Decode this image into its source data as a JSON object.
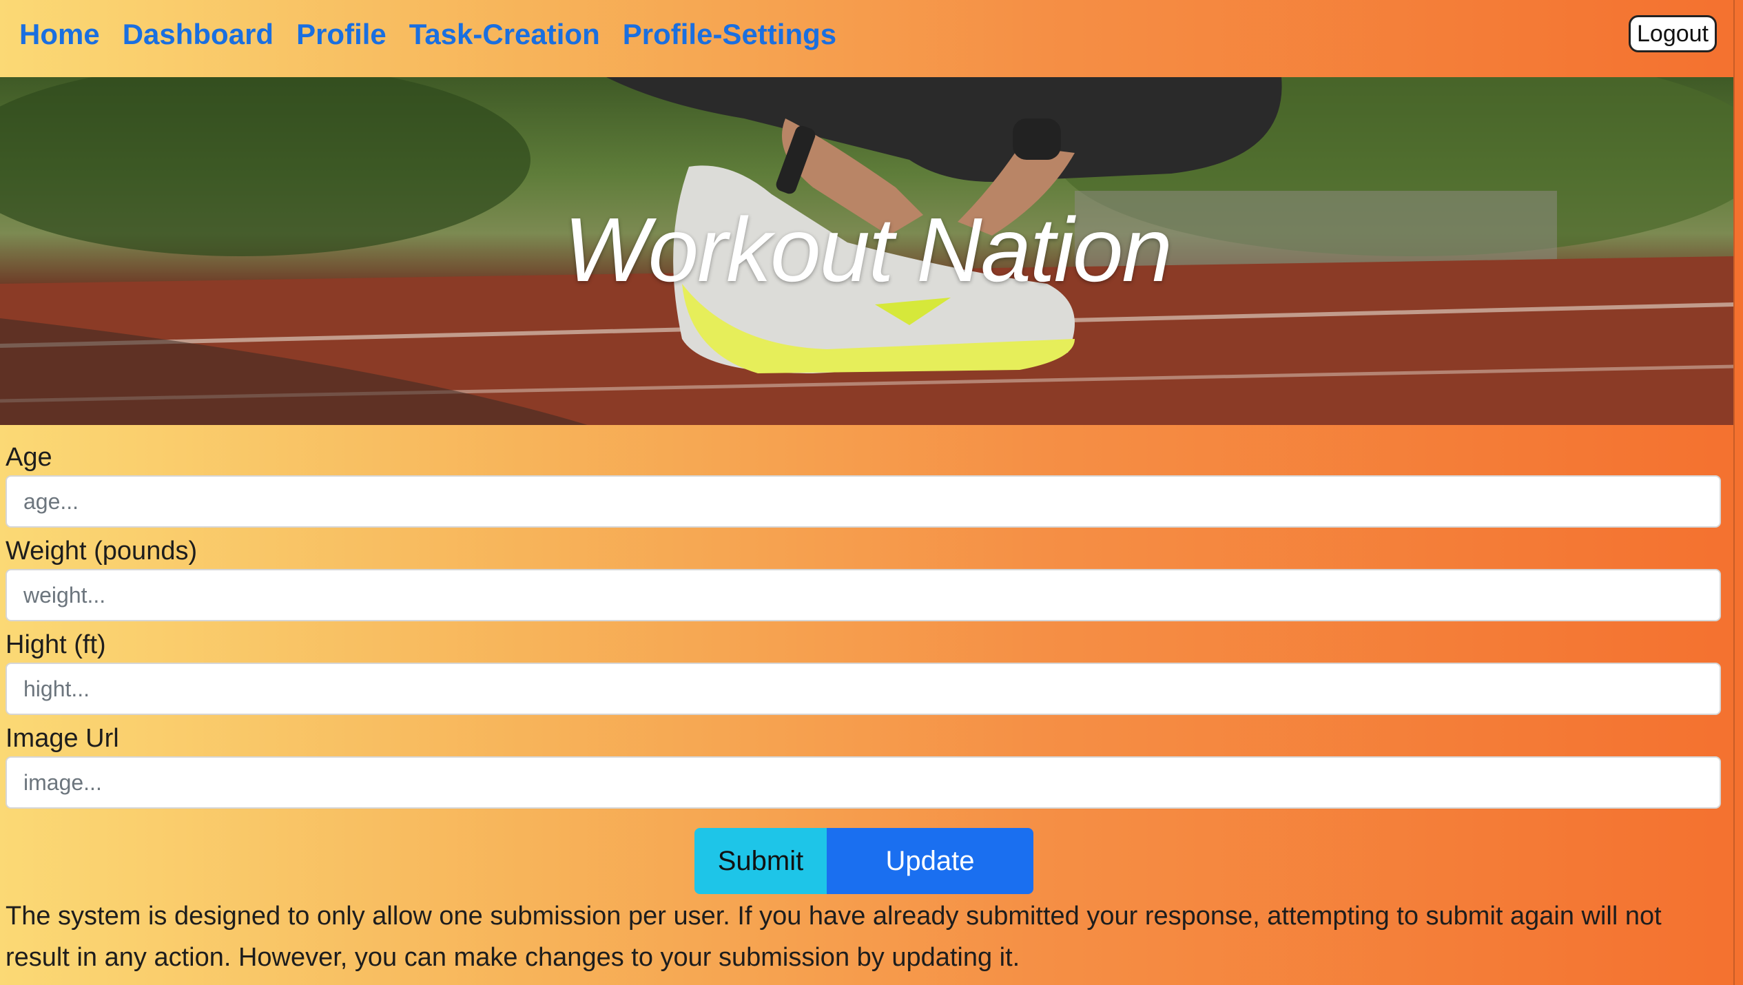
{
  "nav": {
    "links": [
      "Home",
      "Dashboard",
      "Profile",
      "Task-Creation",
      "Profile-Settings"
    ],
    "logout_label": "Logout"
  },
  "hero": {
    "title": "Workout Nation"
  },
  "form": {
    "age": {
      "label": "Age",
      "placeholder": "age..."
    },
    "weight": {
      "label": "Weight (pounds)",
      "placeholder": "weight..."
    },
    "height": {
      "label": "Hight (ft)",
      "placeholder": "hight..."
    },
    "image": {
      "label": "Image Url",
      "placeholder": "image..."
    },
    "submit_label": "Submit",
    "update_label": "Update"
  },
  "notice": "The system is designed to only allow one submission per user. If you have already submitted your response, attempting to submit again will not result in any action. However, you can make changes to your submission by updating it.",
  "colors": {
    "link": "#1a6fe0",
    "submit": "#1ec5e8",
    "update": "#1a6ff0",
    "gradient_start": "#fbd975",
    "gradient_end": "#f4712f"
  }
}
